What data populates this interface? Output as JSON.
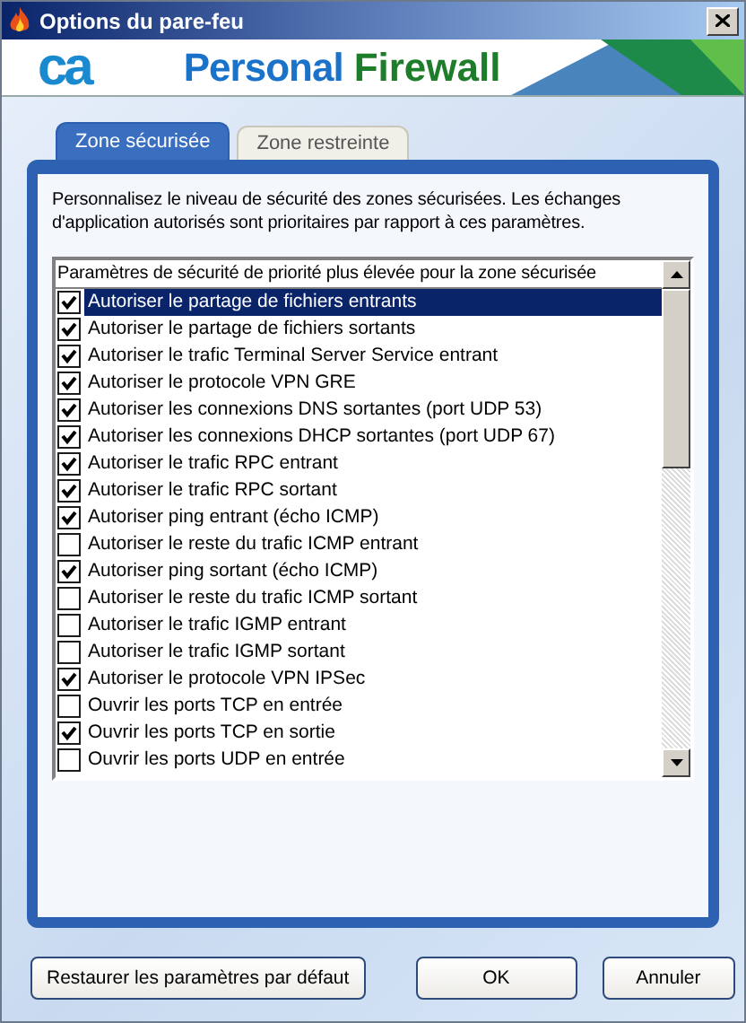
{
  "window": {
    "title": "Options du pare-feu"
  },
  "banner": {
    "logo": "ca",
    "product_first": "Personal",
    "product_second": "Firewall"
  },
  "tabs": [
    {
      "label": "Zone sécurisée",
      "selected": true
    },
    {
      "label": "Zone restreinte",
      "selected": false
    }
  ],
  "description": "Personnalisez le niveau de sécurité des zones sécurisées. Les échanges d'application autorisés sont prioritaires par rapport à ces paramètres.",
  "list": {
    "header": "Paramètres de sécurité de priorité plus élevée pour la zone sécurisée",
    "items": [
      {
        "label": "Autoriser le partage de fichiers entrants",
        "checked": true,
        "selected": true
      },
      {
        "label": "Autoriser le partage de fichiers sortants",
        "checked": true,
        "selected": false
      },
      {
        "label": "Autoriser le trafic Terminal Server Service entrant",
        "checked": true,
        "selected": false
      },
      {
        "label": "Autoriser le protocole VPN GRE",
        "checked": true,
        "selected": false
      },
      {
        "label": "Autoriser les connexions DNS sortantes (port UDP 53)",
        "checked": true,
        "selected": false
      },
      {
        "label": "Autoriser les connexions DHCP sortantes (port UDP 67)",
        "checked": true,
        "selected": false
      },
      {
        "label": "Autoriser le trafic RPC entrant",
        "checked": true,
        "selected": false
      },
      {
        "label": "Autoriser le trafic RPC sortant",
        "checked": true,
        "selected": false
      },
      {
        "label": "Autoriser ping entrant (écho ICMP)",
        "checked": true,
        "selected": false
      },
      {
        "label": "Autoriser le reste du trafic ICMP entrant",
        "checked": false,
        "selected": false
      },
      {
        "label": "Autoriser ping sortant (écho ICMP)",
        "checked": true,
        "selected": false
      },
      {
        "label": "Autoriser le reste du trafic ICMP sortant",
        "checked": false,
        "selected": false
      },
      {
        "label": "Autoriser le trafic IGMP entrant",
        "checked": false,
        "selected": false
      },
      {
        "label": "Autoriser le trafic IGMP sortant",
        "checked": false,
        "selected": false
      },
      {
        "label": "Autoriser le protocole VPN IPSec",
        "checked": true,
        "selected": false
      },
      {
        "label": "Ouvrir les ports TCP en entrée",
        "checked": false,
        "selected": false
      },
      {
        "label": "Ouvrir les ports TCP en sortie",
        "checked": true,
        "selected": false
      },
      {
        "label": "Ouvrir les ports UDP en entrée",
        "checked": false,
        "selected": false
      }
    ]
  },
  "buttons": {
    "restore": "Restaurer les paramètres par défaut",
    "ok": "OK",
    "cancel": "Annuler"
  }
}
